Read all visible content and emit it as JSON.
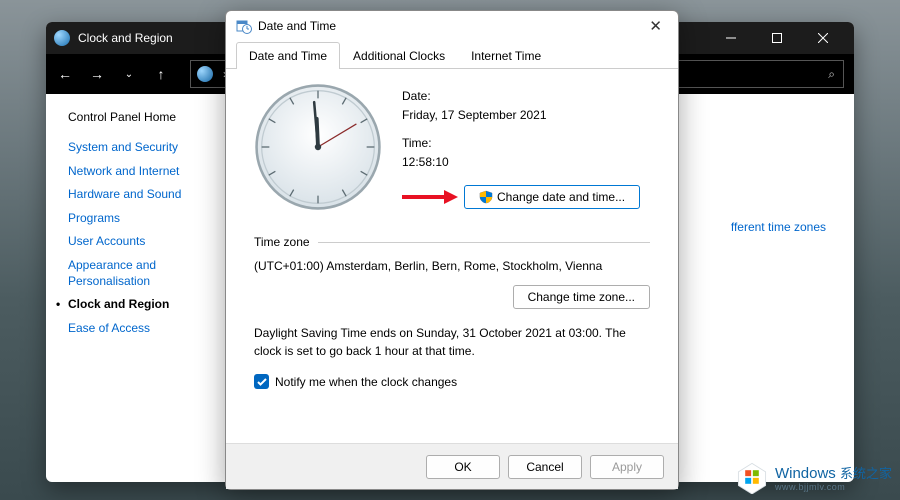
{
  "parent": {
    "title": "Clock and Region",
    "content_fragment": "fferent time zones"
  },
  "sidebar": {
    "home": "Control Panel Home",
    "links": [
      "System and Security",
      "Network and Internet",
      "Hardware and Sound",
      "Programs",
      "User Accounts",
      "Appearance and Personalisation",
      "Clock and Region",
      "Ease of Access"
    ],
    "current_index": 6
  },
  "dialog": {
    "title": "Date and Time",
    "tabs": [
      "Date and Time",
      "Additional Clocks",
      "Internet Time"
    ],
    "active_tab": 0,
    "date_label": "Date:",
    "date_value": "Friday, 17 September 2021",
    "time_label": "Time:",
    "time_value": "12:58:10",
    "change_dt_btn": "Change date and time...",
    "tz_head": "Time zone",
    "tz_value": "(UTC+01:00) Amsterdam, Berlin, Bern, Rome, Stockholm, Vienna",
    "change_tz_btn": "Change time zone...",
    "dst_text": "Daylight Saving Time ends on Sunday, 31 October 2021 at 03:00. The clock is set to go back 1 hour at that time.",
    "notify_label": "Notify me when the clock changes",
    "notify_checked": true,
    "ok": "OK",
    "cancel": "Cancel",
    "apply": "Apply"
  },
  "watermark": {
    "brand": "Windows",
    "cn": "系统之家",
    "url": "www.bjjmlv.com"
  }
}
